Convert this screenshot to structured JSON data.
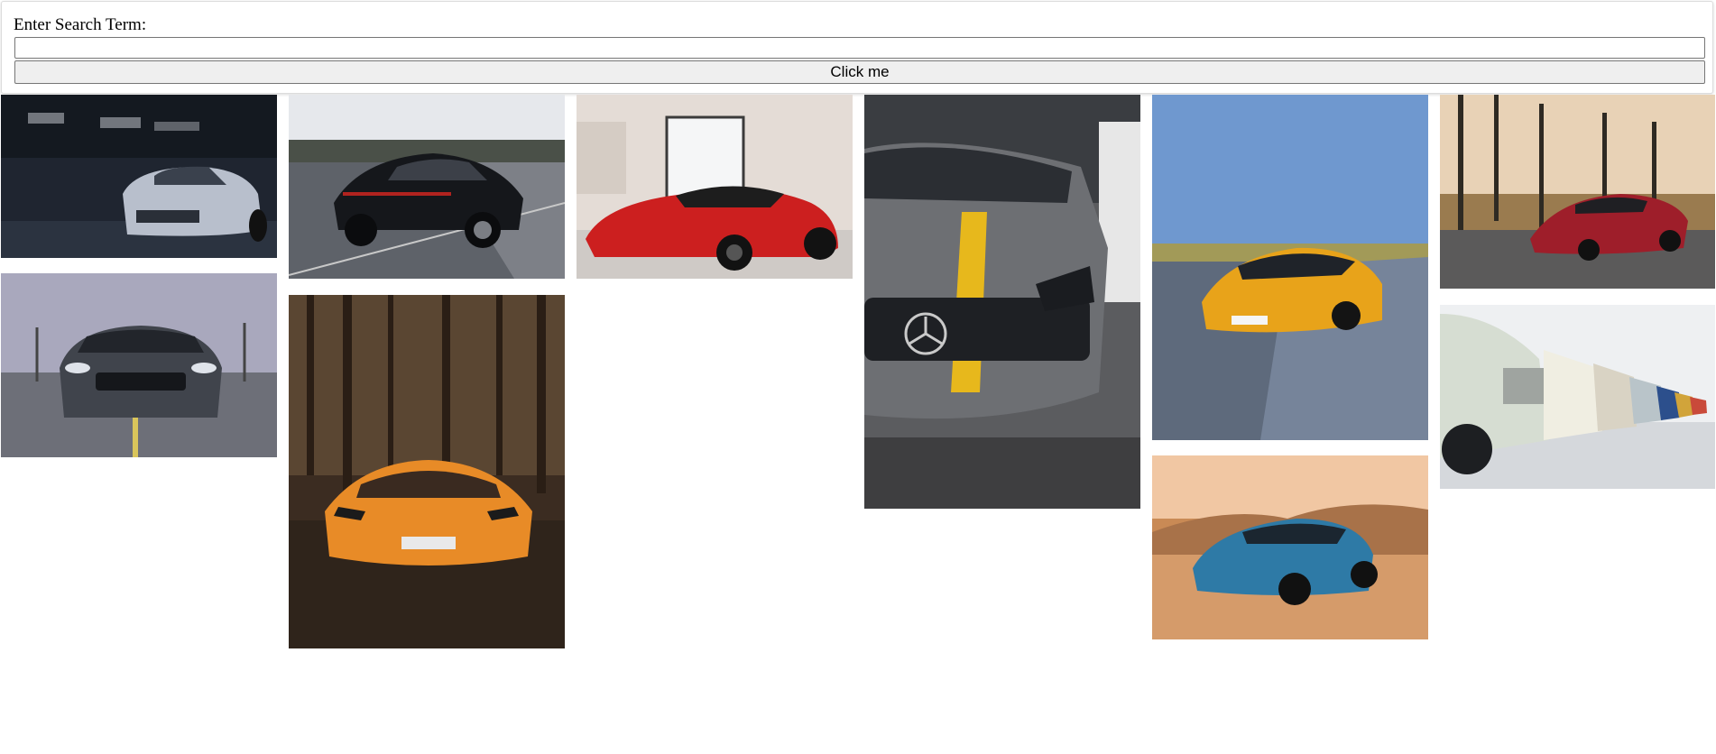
{
  "search": {
    "label": "Enter Search Term:",
    "value": "",
    "placeholder": "",
    "button_label": "Click me"
  },
  "gallery": {
    "images": [
      {
        "subject": "silver Chevrolet Camaro in dark garage"
      },
      {
        "subject": "black Porsche Panamera on highway"
      },
      {
        "subject": "red Ferrari LaFerrari in white garage"
      },
      {
        "subject": "grey Mercedes-AMG with yellow stripe, front close-up"
      },
      {
        "subject": "yellow Mercedes-AMG GT on road"
      },
      {
        "subject": "red Mercedes-AMG GT R in forest clearing"
      },
      {
        "subject": "grey Ford Mustang on parking lot"
      },
      {
        "subject": "orange Lamborghini Aventador in forest"
      },
      {
        "subject": "blue Chevrolet Camaro in desert"
      },
      {
        "subject": "row of classic BMW cars in white hall"
      }
    ]
  }
}
